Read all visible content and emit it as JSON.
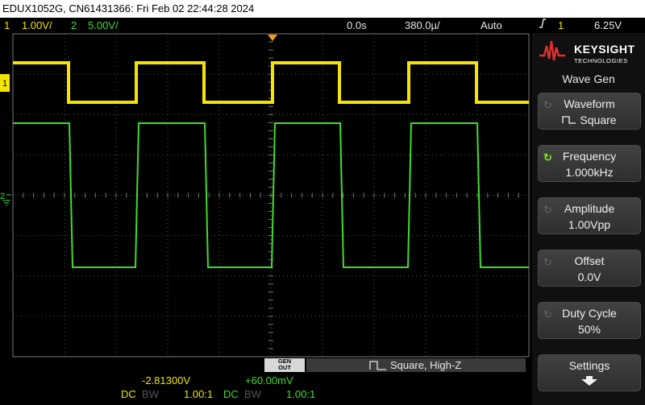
{
  "title_bar": "EDUX1052G, CN61431366: Fri Feb 02 22:44:28 2024",
  "status": {
    "ch1_num": "1",
    "ch1_scale": "1.00V/",
    "ch2_num": "2",
    "ch2_scale": "5.00V/",
    "time_delay": "0.0s",
    "time_scale": "380.0µ/",
    "trigger_mode": "Auto",
    "trigger_channel": "1",
    "trigger_level": "6.25V"
  },
  "brand": {
    "line1": "KEYSIGHT",
    "line2": "TECHNOLOGIES"
  },
  "menu_title": "Wave Gen",
  "softkeys": [
    {
      "label": "Waveform",
      "value": "Square",
      "knob": "inactive"
    },
    {
      "label": "Frequency",
      "value": "1.000kHz",
      "knob": "active"
    },
    {
      "label": "Amplitude",
      "value": "1.00Vpp",
      "knob": "inactive"
    },
    {
      "label": "Offset",
      "value": "0.0V",
      "knob": "inactive"
    },
    {
      "label": "Duty Cycle",
      "value": "50%",
      "knob": "inactive"
    },
    {
      "label": "Settings",
      "value": "",
      "knob": "none"
    }
  ],
  "gen_out": {
    "line1": "GEN",
    "line2": "OUT",
    "status": "Square, High-Z"
  },
  "ch1_readout": {
    "offset": "-2.81300V",
    "coupling": "DC",
    "bw": "BW",
    "probe": "1.00:1"
  },
  "ch2_readout": {
    "offset": "+60.00mV",
    "coupling": "DC",
    "bw": "BW",
    "probe": "1.00:1"
  },
  "colors": {
    "ch1": "#f5e400",
    "ch2": "#3fdd2a",
    "trigger": "#f39c12",
    "active_knob": "#7ee81f"
  },
  "icons": {
    "trigger_slope": "rising-edge-icon",
    "square_wave": "square-wave-icon",
    "knob": "rotate-knob-icon",
    "down_arrow": "down-arrow-icon"
  }
}
